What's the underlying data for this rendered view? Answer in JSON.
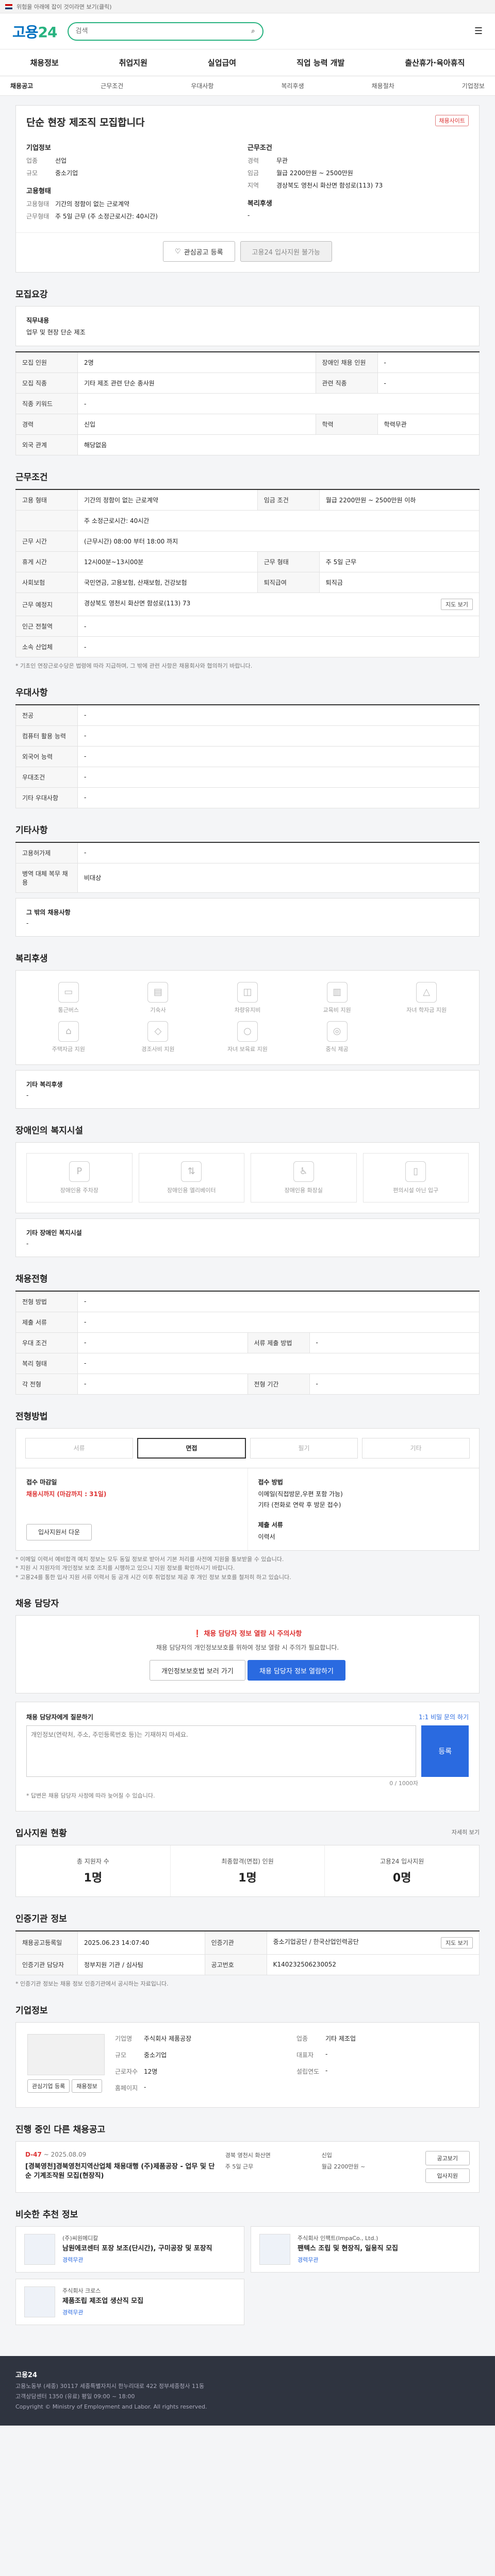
{
  "topbar": {
    "notice": "위험을 아래에 잡이 것이라면 보기(클릭)"
  },
  "header": {
    "logo_a": "고용",
    "logo_b": "24",
    "search_placeholder": "검색"
  },
  "gnb": [
    "채용정보",
    "취업지원",
    "실업급여",
    "직업 능력 개발",
    "출산휴가·육아휴직"
  ],
  "subtabs": [
    "채용공고",
    "근무조건",
    "우대사항",
    "복리후생",
    "채용절차",
    "기업정보"
  ],
  "job": {
    "title": "단순 현장 제조직 모집합니다",
    "badge": "채용사이트",
    "company_group": "기업정보",
    "company": [
      {
        "k": "업종",
        "v": "선업"
      },
      {
        "k": "규모",
        "v": "중소기업"
      }
    ],
    "cond_group": "근무조건",
    "cond": [
      {
        "k": "경력",
        "v": "무관"
      },
      {
        "k": "임금",
        "v": "월급 2200만원 ~ 2500만원"
      },
      {
        "k": "지역",
        "v": "경상북도 영천시 화산면 함성로(113) 73"
      }
    ],
    "hire_group": "고용형태",
    "hire": [
      {
        "k": "고용형태",
        "v": "기간의 정함이 없는 근로계약"
      },
      {
        "k": "근무형태",
        "v": "주 5일 근무 (주 소정근로시간: 40시간)"
      }
    ],
    "welfare_group": "복리후생",
    "welfare": "-",
    "fav_button": "관심공고 등록",
    "apply_button": "고용24 입사지원 불가능"
  },
  "recruit": {
    "title": "모집요강",
    "job_content_label": "직무내용",
    "job_content": "업무 및 현장 단순 제조",
    "rows": [
      {
        "k": "모집 인원",
        "v": "2명",
        "k2": "장애인 채용 인원",
        "v2": "-"
      },
      {
        "k": "모집 직종",
        "v": "기타 제조 관련 단순 종사원",
        "k2": "관련 직종",
        "v2": "-"
      },
      {
        "k": "직종 키워드",
        "v": "-",
        "k2": "",
        "v2": ""
      },
      {
        "k": "경력",
        "v": "신입",
        "k2": "학력",
        "v2": "학력무관"
      },
      {
        "k": "외국 관계",
        "v": "해당없음",
        "k2": "",
        "v2": ""
      }
    ]
  },
  "work": {
    "title": "근무조건",
    "rows": [
      {
        "k": "고용 형태",
        "v": "기간의 정함이 없는 근로계약",
        "k2": "임금 조건",
        "v2": "월급 2200만원 ~ 2500만원 이하"
      },
      {
        "k": "",
        "v": "주 소정근로시간: 40시간",
        "k2": "",
        "v2": ""
      },
      {
        "k": "근무 시간",
        "v": "(근무시간) 08:00 부터 18:00 까지",
        "k2": "",
        "v2": ""
      },
      {
        "k": "휴게 시간",
        "v": "12시00분~13시00분",
        "k2": "근무 형태",
        "v2": "주 5일 근무"
      },
      {
        "k": "사회보험",
        "v": "국민연금, 고용보험, 산재보험, 건강보험",
        "k2": "퇴직급여",
        "v2": "퇴직금"
      },
      {
        "k": "근무 예정지",
        "v": "경상북도 영천시 화산면 함성로(113) 73",
        "k2": "",
        "v2": ""
      },
      {
        "k": "인근 전철역",
        "v": "-",
        "k2": "",
        "v2": ""
      },
      {
        "k": "소속 산업체",
        "v": "-",
        "k2": "",
        "v2": ""
      }
    ],
    "map_button": "지도 보기",
    "note": "* 기초인 연장근로수당은 법령에 따라 지급하며, 그 밖에 관련 사항은 채용회사와 협의하기 바랍니다."
  },
  "pref": {
    "title": "우대사항",
    "rows": [
      {
        "k": "전공",
        "v": "-"
      },
      {
        "k": "컴퓨터 활용 능력",
        "v": "-"
      },
      {
        "k": "외국어 능력",
        "v": "-"
      },
      {
        "k": "우대조건",
        "v": "-"
      },
      {
        "k": "기타 우대사항",
        "v": "-"
      }
    ]
  },
  "etc": {
    "title": "기타사항",
    "rows": [
      {
        "k": "고용허가제",
        "v": "-"
      },
      {
        "k": "병역 대체 복무 채용",
        "v": "비대상"
      }
    ],
    "more_label": "그 밖의 채용사항",
    "more": "-"
  },
  "welfare": {
    "title": "복리후생",
    "items": [
      "통근버스",
      "기숙사",
      "차량유지비",
      "교육비 지원",
      "자녀 학자금 지원",
      "주택자금 지원",
      "경조사비 지원",
      "자녀 보육료 지원",
      "중식 제공"
    ],
    "other_label": "기타 복리후생",
    "other": "-"
  },
  "disab": {
    "title": "장애인의 복지시설",
    "items": [
      "장애인용 주차장",
      "장애인용 엘리베이터",
      "장애인용 화장실",
      "편의시설 아닌 입구"
    ],
    "other_label": "기타 장애인 복지시설",
    "other": "-"
  },
  "selection": {
    "title": "채용전형",
    "rows": [
      {
        "k": "전형 방법",
        "v": "-",
        "k2": "",
        "v2": ""
      },
      {
        "k": "제출 서류",
        "v": "-",
        "k2": "",
        "v2": ""
      },
      {
        "k": "우대 조건",
        "v": "-",
        "k2": "서류 제출 방법",
        "v2": "-"
      },
      {
        "k": "복리 형태",
        "v": "-",
        "k2": "",
        "v2": ""
      },
      {
        "k": "각 전형",
        "v": "-",
        "k2": "전형 기간",
        "v2": "-"
      }
    ]
  },
  "process": {
    "title": "전형방법",
    "steps": [
      "서류",
      "면접",
      "필기",
      "기타"
    ],
    "deadline_label": "접수 마감일",
    "deadline": "채용시까지 (마감까지 : 31일)",
    "method_label": "접수 방법",
    "method": "이메일(직접방문,우편 포함 가능)",
    "method2": "기타 (전화로 연락 후 방문 접수)",
    "form_button": "입사지원서 다운",
    "form_label": "제출 서류",
    "form": "이력서",
    "notes": [
      "* 이메일 이력서 예비합격 예치 정보는 모두 동일 정보로 받아서 기본 처리를 사전에 지원을 통보받을 수 있습니다.",
      "* 지원 시 지원자의 개인정보 보호 조치를 시행하고 있으니 지원 정보를 확인하시기 바랍니다.",
      "* 고용24를 통한 입사 지원 서류 이력서 등 공개 시간 이후 취업정보 제공 후 개인 정보 보호를 철저히 하고 있습니다."
    ]
  },
  "contact": {
    "title": "채용 담당자",
    "warn": "채용 담당자 정보 열람 시 주의사항",
    "desc": "채용 담당자의 개인정보보호를 위하여 정보 열람 시 주의가 필요합니다.",
    "b1": "개인정보보호법 보러 가기",
    "b2": "채용 담당자 정보 열람하기"
  },
  "qa": {
    "title": "채용 담당자에게 질문하기",
    "placeholder": "개인정보(연락처, 주소, 주민등록번호 등)는 기재하지 마세요.",
    "count": "0 / 1000자",
    "submit": "등록",
    "hint": "1:1 비밀 문의 하기",
    "note": "* 답변은 채용 담당자 사정에 따라 늦어질 수 있습니다."
  },
  "status": {
    "title": "입사지원 현황",
    "more": "자세히 보기",
    "items": [
      {
        "label": "총 지원자 수",
        "value": "1명"
      },
      {
        "label": "최종합격(면접) 인원",
        "value": "1명"
      },
      {
        "label": "고용24 입사지원",
        "value": "0명"
      }
    ]
  },
  "info": {
    "title": "인증기관 정보",
    "rows": [
      {
        "k": "채용공고등록일",
        "v": "2025.06.23 14:07:40",
        "k2": "인증기관",
        "v2": "중소기업공단 / 한국산업인력공단"
      },
      {
        "k": "인증기관 담당자",
        "v": "정부지원 기관 / 심사팀",
        "k2": "공고번호",
        "v2": "K140232506230052"
      }
    ],
    "btn": "지도 보기",
    "note": "* 인증기관 정보는 채용 정보 인증기관에서 공시하는 자료입니다."
  },
  "company": {
    "title": "기업정보",
    "name": "주식회사 제품공장",
    "rows": [
      {
        "k": "기업명",
        "v": "주식회사 제품공장"
      },
      {
        "k": "업종",
        "v": "기타 제조업"
      },
      {
        "k": "규모",
        "v": "중소기업"
      },
      {
        "k": "대표자",
        "v": "-"
      },
      {
        "k": "근로자수",
        "v": "12명"
      },
      {
        "k": "설립연도",
        "v": "-"
      },
      {
        "k": "홈페이지",
        "v": "-"
      }
    ],
    "b1": "관심기업 등록",
    "b2": "채용정보"
  },
  "dept": {
    "title": "진행 중인 다른 채용공고",
    "dday": "D-47",
    "date": "~ 2025.08.09",
    "post_title": "[경북영천]경북영천지역산업체 채용대행 (주)제품공장 - 업무 및 단순 기계조작원 모집(현장직)",
    "meta": [
      "경북 영천시 화산면",
      "신입",
      "주 5일 근무",
      "월급 2200만원 ~"
    ],
    "b1": "공고보기",
    "b2": "입사지원"
  },
  "similar": {
    "title": "비슷한 추천 정보",
    "cards": [
      {
        "company": "(주)씨원메디칼",
        "title": "남원에코센터 포장 보조(단시간), 구미공장 및 포장직",
        "tag": "경력무관"
      },
      {
        "company": "주식회사 인팩트(ImpaCo., Ltd.)",
        "title": "팬텍스 조립 및 현장직, 일용직 모집",
        "tag": "경력무관"
      },
      {
        "company": "주식회사 크로스",
        "title": "제품조립 제조업 생산직 모집",
        "tag": "경력무관"
      }
    ]
  },
  "footer": {
    "brand": "고용24",
    "lines": [
      "고용노동부 (세종) 30117 세종특별자치시 한누리대로 422 정부세종청사 11동",
      "고객상담센터 1350 (유료) 평일 09:00 ~ 18:00",
      "Copyright © Ministry of Employment and Labor. All rights reserved."
    ]
  }
}
